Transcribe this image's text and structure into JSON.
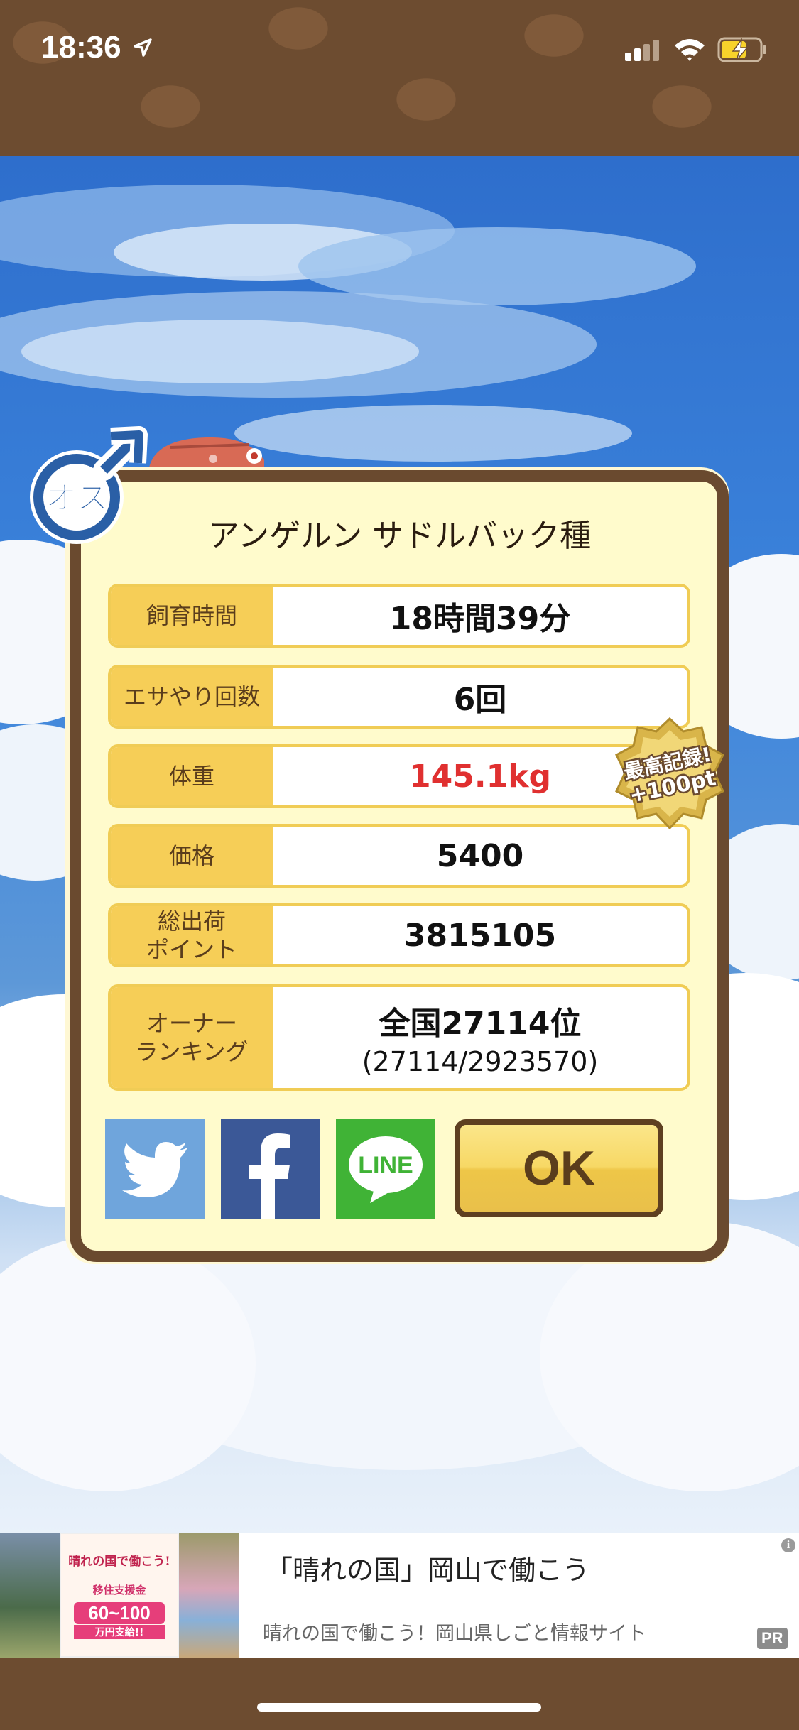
{
  "status_bar": {
    "time": "18:36"
  },
  "gender": {
    "label": "オス"
  },
  "result": {
    "species": "アンゲルン サドルバック種",
    "rows": [
      {
        "label": "飼育時間",
        "value": "18時間39分"
      },
      {
        "label": "エサやり回数",
        "value": "6回"
      },
      {
        "label": "体重",
        "value": "145.1kg",
        "highlight": "#e03030"
      },
      {
        "label": "価格",
        "value": "5400"
      },
      {
        "label": "総出荷\nポイント",
        "value": "3815105"
      },
      {
        "label": "オーナー\nランキング",
        "value": "全国27114位",
        "sub": "(27114/2923570)"
      }
    ],
    "record_badge": {
      "line1": "最高記録!",
      "line2": "+100pt"
    }
  },
  "share": {
    "twitter": "twitter-share",
    "facebook": "f",
    "line": "LINE"
  },
  "ok_button": "OK",
  "ad": {
    "title": "「晴れの国」岡山で働こう",
    "description": "晴れの国で働こう！岡山県しごと情報サイト",
    "pr": "PR",
    "info": "i",
    "image_headline": "晴れの国で働こう!",
    "image_sub": "移住支援金",
    "image_amount": "60~100",
    "image_unit": "万円支給!!"
  },
  "colors": {
    "frame_brown": "#6a4a2f",
    "label_yellow": "#f6ce57",
    "twitter": "#6fa5dc",
    "facebook": "#3b5897",
    "line": "#40b336"
  }
}
